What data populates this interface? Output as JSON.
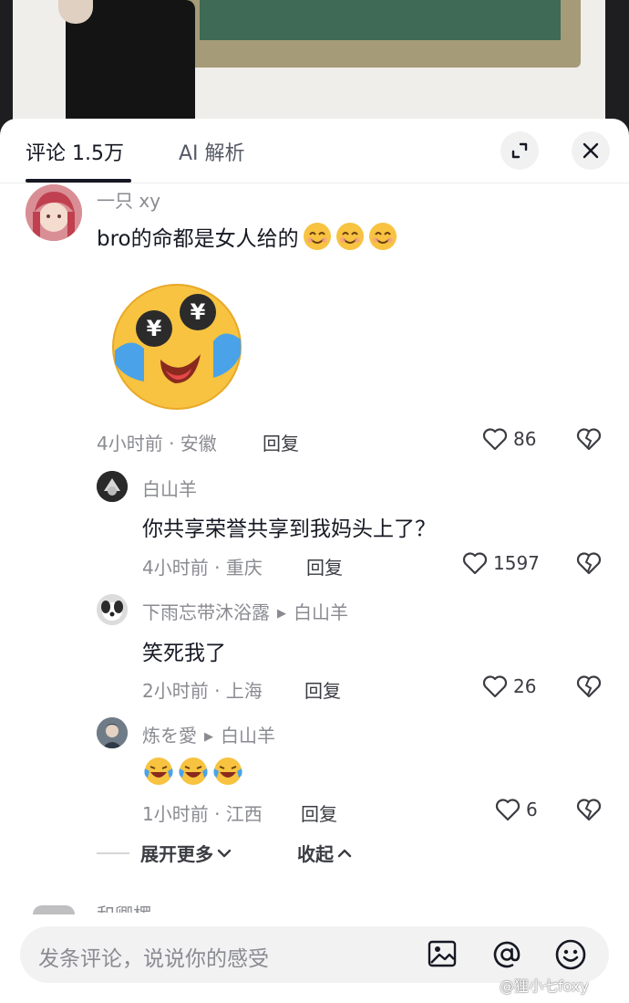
{
  "tabs": {
    "comments": "评论 1.5万",
    "ai": "AI 解析"
  },
  "comments": [
    {
      "user": "一只 xy",
      "text": "bro的命都是女人给的",
      "time": "4小时前 · 安徽",
      "reply_label": "回复",
      "likes": "86"
    },
    {
      "user": "白山羊",
      "text": "你共享荣誉共享到我妈头上了？",
      "time": "4小时前 · 重庆",
      "reply_label": "回复",
      "likes": "1597"
    },
    {
      "user": "下雨忘带沐浴露",
      "reply_to": "白山羊",
      "text": "笑死我了",
      "time": "2小时前 · 上海",
      "reply_label": "回复",
      "likes": "26"
    },
    {
      "user": "炼を愛",
      "reply_to": "白山羊",
      "time": "1小时前 · 江西",
      "reply_label": "回复",
      "likes": "6"
    }
  ],
  "expand_more": "展开更多",
  "collapse": "收起",
  "next_user_peek": "和卿椤",
  "input": {
    "placeholder": "发条评论，说说你的感受"
  },
  "watermark": "@狸小七foxy",
  "colors": {
    "emoji_yellow": "#f7c340",
    "tear_blue": "#4aa3e8",
    "text_primary": "#161823",
    "text_secondary": "#8a8b91"
  }
}
